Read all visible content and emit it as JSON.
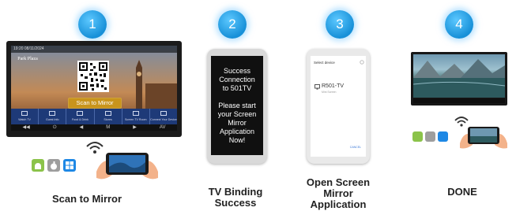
{
  "steps": [
    {
      "number": "1",
      "caption": "Scan to Mirror"
    },
    {
      "number": "2",
      "caption": "TV Binding Success"
    },
    {
      "number": "3",
      "caption": "Open Screen Mirror Application"
    },
    {
      "number": "4",
      "caption": "DONE"
    }
  ],
  "tv1": {
    "status_bar": "19:20   08/11/2024",
    "logo_text": "Park Plaza",
    "scan_button": "Scan to Mirror",
    "tiles": [
      "Watch TV",
      "Guest Info",
      "Food & Drink",
      "Stores",
      "Screen TV Room",
      "Connect Your Device"
    ],
    "controls": [
      "◀◀",
      "⏻",
      "◀",
      "M",
      "▶",
      "AV"
    ]
  },
  "phone2": {
    "message_lines": [
      "Success",
      "Connection",
      "to 501TV",
      "",
      "Please start",
      "your Screen",
      "Mirror",
      "Application",
      "Now!"
    ]
  },
  "phone3": {
    "dialog_title": "Select device",
    "device_name": "R501-TV",
    "device_sub": "Mini Screen",
    "cancel": "CANCEL"
  },
  "colors": {
    "step_badge": "#1790d8",
    "scan_button": "#c8941c",
    "tile_bar": "#1e3a78",
    "android": "#8bc34a",
    "apple": "#9e9e9e",
    "windows": "#1e88e5"
  },
  "icons": [
    "wifi-icon",
    "android-icon",
    "apple-icon",
    "windows-icon",
    "phone-icon",
    "hand-icon"
  ]
}
